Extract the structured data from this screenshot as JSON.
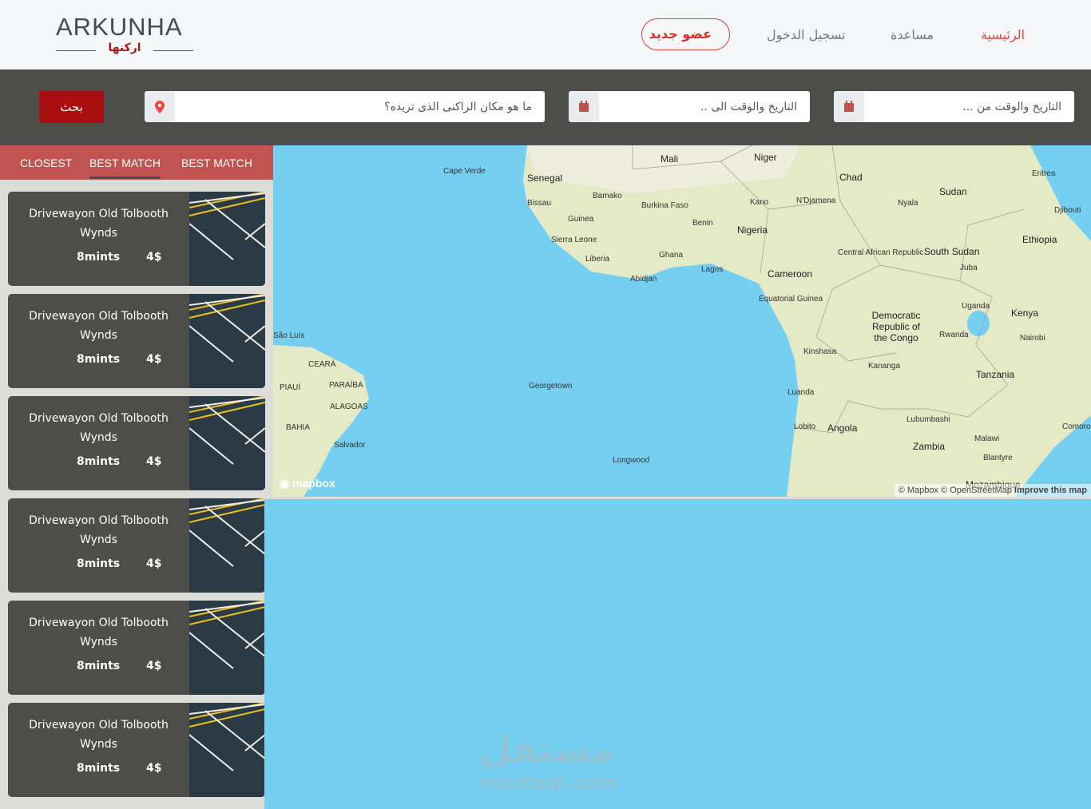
{
  "header": {
    "logo_en": "ARKUNHA",
    "logo_ar": "اركنها",
    "nav": {
      "home": "الرئيسية",
      "help": "مساعدة",
      "login": "تسجيل الدخول",
      "new_member": "عضو جديد"
    }
  },
  "search": {
    "from_placeholder": "التاريخ والوقت من ...",
    "to_placeholder": "التاريخ والوقت الى ..",
    "location_placeholder": "ما هو مكان الراكنى الذى تريده؟",
    "search_label": "بحث"
  },
  "tabs": [
    {
      "label": "CLOSEST"
    },
    {
      "label": "BEST MATCH"
    },
    {
      "label": "BEST MATCH"
    }
  ],
  "listings": [
    {
      "title": "Drivewayon Old Tolbooth Wynds",
      "time": "8mints",
      "price": "4$"
    },
    {
      "title": "Drivewayon Old Tolbooth Wynds",
      "time": "8mints",
      "price": "4$"
    },
    {
      "title": "Drivewayon Old Tolbooth Wynds",
      "time": "8mints",
      "price": "4$"
    },
    {
      "title": "Drivewayon Old Tolbooth Wynds",
      "time": "8mints",
      "price": "4$"
    },
    {
      "title": "Drivewayon Old Tolbooth Wynds",
      "time": "8mints",
      "price": "4$"
    },
    {
      "title": "Drivewayon Old Tolbooth Wynds",
      "time": "8mints",
      "price": "4$"
    }
  ],
  "map": {
    "labels": [
      "Mali",
      "Niger",
      "Chad",
      "Sudan",
      "Eritrea",
      "Djibouti",
      "Ethiopia",
      "Senegal",
      "Cape Verde",
      "Bamako",
      "Bissau",
      "Guinea",
      "Burkina Faso",
      "Kano",
      "N'Djamena",
      "Nyala",
      "Nigeria",
      "Benin",
      "Sierra Leone",
      "Liberia",
      "Ghana",
      "Abidjan",
      "Lagos",
      "Cameroon",
      "Central African Republic",
      "South Sudan",
      "Juba",
      "Equatorial Guinea",
      "Democratic Republic of the Congo",
      "Uganda",
      "Kenya",
      "Rwanda",
      "Nairobi",
      "Kinshasa",
      "Kananga",
      "Tanzania",
      "Luanda",
      "Lobito",
      "Angola",
      "Lubumbashi",
      "Zambia",
      "Malawi",
      "Blantyre",
      "Comoros",
      "Georgetown",
      "Longwood",
      "São Luís",
      "CEARÁ",
      "PIAUÍ",
      "PARAÍBA",
      "ALAGOAS",
      "BAHIA",
      "Salvador",
      "Mozambique"
    ],
    "brand": "mapbox",
    "attribution": "© Mapbox © OpenStreetMap",
    "improve": "Improve this map"
  },
  "watermark": {
    "ar": "مستقل",
    "en": "mostaql.com"
  },
  "colors": {
    "accent": "#a90f0f",
    "tabs": "#c15450",
    "water": "#75cfef",
    "dark": "#4d4d4b"
  }
}
